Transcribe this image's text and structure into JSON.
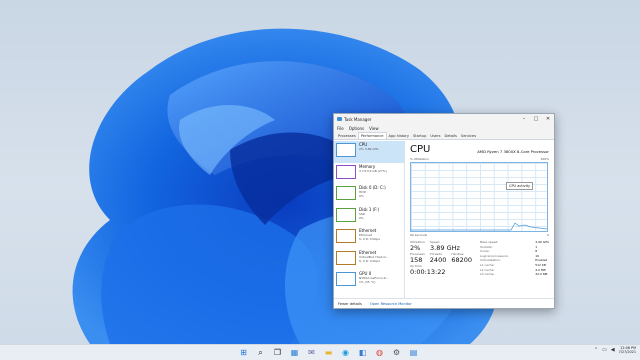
{
  "window": {
    "title": "Task Manager",
    "controls": {
      "minimize": "–",
      "maximize": "□",
      "close": "✕"
    }
  },
  "menu": [
    "File",
    "Options",
    "View"
  ],
  "tabs": [
    "Processes",
    "Performance",
    "App history",
    "Startup",
    "Users",
    "Details",
    "Services"
  ],
  "active_tab": "Performance",
  "sidebar": [
    {
      "name": "CPU",
      "sub1": "2%  3.89 GHz",
      "sub2": ""
    },
    {
      "name": "Memory",
      "sub1": "3.7/13.9 GB (27%)",
      "sub2": ""
    },
    {
      "name": "Disk 0 (D: C:)",
      "sub1": "HDD",
      "sub2": "0%"
    },
    {
      "name": "Disk 1 (F:)",
      "sub1": "SSD",
      "sub2": "0%"
    },
    {
      "name": "Ethernet",
      "sub1": "Ethernet",
      "sub2": "S: 0 R: 0 Kbps"
    },
    {
      "name": "Ethernet",
      "sub1": "VirtualBox Host-O...",
      "sub2": "S: 0 R: 0 Kbps"
    },
    {
      "name": "GPU 0",
      "sub1": "NVIDIA GeForce R...",
      "sub2": "1% (35 °C)"
    }
  ],
  "cpu": {
    "title": "CPU",
    "model": "AMD Ryzen 7 3800X 8-Core Processor",
    "graph_label_left": "% Utilization",
    "graph_label_right": "100%",
    "graph_foot_left": "60 seconds",
    "graph_foot_right": "0",
    "tooltip": "CPU activity",
    "stats": {
      "utilization_label": "Utilization",
      "utilization": "2%",
      "speed_label": "Speed",
      "speed": "3.89 GHz",
      "processes_label": "Processes",
      "processes": "158",
      "threads_label": "Threads",
      "threads": "2400",
      "handles_label": "Handles",
      "handles": "68200",
      "uptime_label": "Up time",
      "uptime": "0:00:13:22"
    },
    "details": [
      {
        "k": "Base speed:",
        "v": "3.90 GHz"
      },
      {
        "k": "Sockets:",
        "v": "1"
      },
      {
        "k": "Cores:",
        "v": "8"
      },
      {
        "k": "Logical processors:",
        "v": "16"
      },
      {
        "k": "Virtualization:",
        "v": "Enabled"
      },
      {
        "k": "L1 cache:",
        "v": "512 KB"
      },
      {
        "k": "L2 cache:",
        "v": "4.0 MB"
      },
      {
        "k": "L3 cache:",
        "v": "32.0 MB"
      }
    ]
  },
  "footer": {
    "fewer_details": "Fewer details",
    "resource_monitor": "Open Resource Monitor"
  },
  "taskbar": {
    "icons": [
      "windows-icon",
      "search-icon",
      "task-view-icon",
      "widgets-icon",
      "chat-icon",
      "file-explorer-icon",
      "edge-icon",
      "store-icon",
      "chrome-icon",
      "settings-icon",
      "task-manager-icon"
    ],
    "time": "12:06 PM",
    "date": "7/27/2021"
  }
}
